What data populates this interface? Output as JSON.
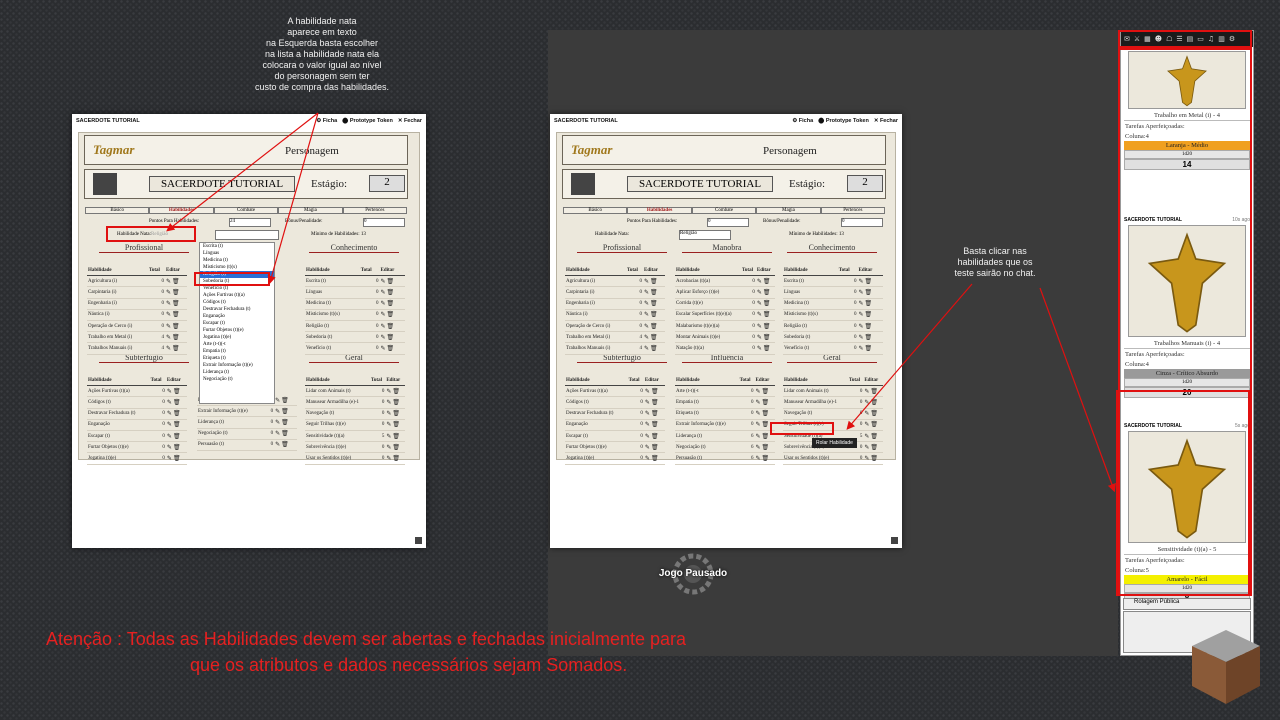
{
  "annotations": {
    "top_note": [
      "A habilidade nata",
      "aparece em texto",
      "na Esquerda basta escolher",
      "na lista a habilidade nata ela",
      "colocara o valor igual ao nível",
      "do personagem sem ter",
      "custo de compra das habilidades."
    ],
    "right_note": [
      "Basta clicar nas",
      "habilidades que os",
      "teste sairão no chat."
    ],
    "warning": [
      "Atenção : Todas as Habilidades devem ser abertas e fechadas inicialmente para",
      "que os atributos e dados necessários sejam Somados."
    ]
  },
  "window": {
    "title": "SACERDOTE TUTORIAL",
    "actions": [
      "⚙ Ficha",
      "⬤ Prototype Token",
      "✕ Fechar"
    ]
  },
  "sheet": {
    "logo": "Tagmar",
    "header_label": "Personagem",
    "char_name": "SACERDOTE TUTORIAL",
    "stage_label": "Estágio:",
    "stage_value": "2",
    "tabs": [
      "Básico",
      "Habilidades",
      "Combate",
      "Magia",
      "Pertences"
    ],
    "points_label": "Pontos Para Habilidades:",
    "points_value_left": "24",
    "points_value_right": "0",
    "penalty_label": "Bônus/Penalidade:",
    "penalty_value": "0",
    "nata_label": "Habilidade Nata:",
    "nata_value_left": "Religião",
    "nata_value_right": "Religião",
    "min_label": "Mínimo de Habilidades: 13",
    "header_cols": [
      "Habilidade",
      "Total",
      "Editar"
    ],
    "edit_icons": "✎🗑",
    "profissional": {
      "title": "Profissional",
      "rows": [
        [
          "Agricultura (i)",
          "0"
        ],
        [
          "Carpintaria (i)",
          "0"
        ],
        [
          "Engenharia (i)",
          "0"
        ],
        [
          "Náutica (i)",
          "0"
        ],
        [
          "Operação de Cerco (i)",
          "0"
        ],
        [
          "Trabalho em Metal (i)",
          "4"
        ],
        [
          "Trabalhos Manuais (i)",
          "4"
        ]
      ]
    },
    "manobra": {
      "title": "Manobra",
      "rows": [
        [
          "Acrobacias (t)(a)",
          "0"
        ],
        [
          "Aplicar Esforço (t)(e)",
          "0"
        ],
        [
          "Corrida (t)(e)",
          "0"
        ],
        [
          "Escalar Superfícies (t)(e)(a)",
          "0"
        ],
        [
          "Malabarismo (t)(e)(a)",
          "0"
        ],
        [
          "Montar Animais (t)(e)",
          "0"
        ],
        [
          "Natação (t)(a)",
          "0"
        ]
      ]
    },
    "conhecimento": {
      "title": "Conhecimento",
      "rows": [
        [
          "Escrita (t)",
          "0"
        ],
        [
          "Línguas",
          "0"
        ],
        [
          "Medicina (t)",
          "0"
        ],
        [
          "Misticismo (t)(s)",
          "0"
        ],
        [
          "Religião (t)",
          "0"
        ],
        [
          "Sobedoria (t)",
          "0"
        ],
        [
          "Venefício (t)",
          "0"
        ]
      ]
    },
    "subterfugio": {
      "title": "Subterfúgio",
      "rows": [
        [
          "Ações Furtivas (t)(a)",
          "0"
        ],
        [
          "Códigos (t)",
          "0"
        ],
        [
          "Destravar Fechadura (t)",
          "0"
        ],
        [
          "Enganação",
          "0"
        ],
        [
          "Escapar (t)",
          "0"
        ],
        [
          "Furtar Objetos (t)(e)",
          "0"
        ],
        [
          "Jogatina (t)(e)",
          "0"
        ]
      ]
    },
    "influencia": {
      "title": "Influência",
      "rows": [
        [
          "Arte (t-t)(-t",
          "0"
        ],
        [
          "Empatia (t)",
          "0"
        ],
        [
          "Etiqueta (t)",
          "0"
        ],
        [
          "Extrair Informação (t)(e)",
          "0"
        ],
        [
          "Liderança (t)",
          "6"
        ],
        [
          "Negociação (t)",
          "6"
        ],
        [
          "Persuasão (t)",
          "6"
        ]
      ]
    },
    "geral": {
      "title": "Geral",
      "rows": [
        [
          "Lidar com Animais (t)",
          "0"
        ],
        [
          "Manusear Armadilha (e)-1",
          "0"
        ],
        [
          "Navegação (t)",
          "0"
        ],
        [
          "Seguir Trilhas (t)(e)",
          "0"
        ],
        [
          "Sensitividade (t)(a)",
          "5"
        ],
        [
          "Sobrevivência (t)(e)",
          "0"
        ],
        [
          "Usar os Sentidos (t)(e)",
          "0"
        ]
      ]
    },
    "left_influencia_partial": [
      [
        "Etiqueta (t)",
        "0"
      ],
      [
        "Extrair Informação (t)(e)",
        "0"
      ],
      [
        "Liderança (t)",
        "0"
      ],
      [
        "Negociação (t)",
        "0"
      ],
      [
        "Persuasão (t)",
        "0"
      ]
    ]
  },
  "dropdown_items": [
    "Escrita (t)",
    "Línguas",
    "Medicina (t)",
    "Misticismo (t)(s)",
    "Religião (t)",
    "Sobedoria (t)",
    "Venefício (t)",
    "Ações Furtivas (t)(a)",
    "Códigos (t)",
    "Destravar Fechadura (t)",
    "Enganação",
    "Escapar (t)",
    "Furtar Objetos (t)(e)",
    "Jogatina (t)(e)",
    "Arte (t-t)(-t",
    "Empatia (t)",
    "Etiqueta (t)",
    "Extrair Informação (t)(e)",
    "Liderança (t)",
    "Negociação (t)"
  ],
  "dropdown_selected": "Religião (t)",
  "tooltip": "Rolar Habilidade",
  "paused": "Jogo Pausado",
  "chat": {
    "cards": [
      {
        "who": "",
        "ago": "",
        "caption": "Trabalho em Metal (i) - 4",
        "tarefas": "Tarefas Aperfeiçoadas:",
        "coluna": "Coluna:4",
        "band": "Laranja - Médio",
        "band_color": "#f0a020",
        "dice": "1d20",
        "result": "14"
      },
      {
        "who": "SACERDOTE TUTORIAL",
        "ago": "10s ago",
        "caption": "Trabalhos Manuais (i) - 4",
        "tarefas": "Tarefas Aperfeiçoadas:",
        "coluna": "Coluna:4",
        "band": "Cinza - Crítico Absurdo",
        "band_color": "#9a9a9a",
        "dice": "1d20",
        "result": "20"
      },
      {
        "who": "SACERDOTE TUTORIAL",
        "ago": "5s ago",
        "caption": "Sensitividade (t)(a) - 5",
        "tarefas": "Tarefas Aperfeiçoadas:",
        "coluna": "Coluna:5",
        "band": "Amarelo - Fácil",
        "band_color": "#f4f000",
        "dice": "1d20",
        "result": "8"
      }
    ],
    "select_value": "Rolagem Pública"
  },
  "colors": {
    "accent_red": "#e01010",
    "gold": "#c8961c"
  }
}
